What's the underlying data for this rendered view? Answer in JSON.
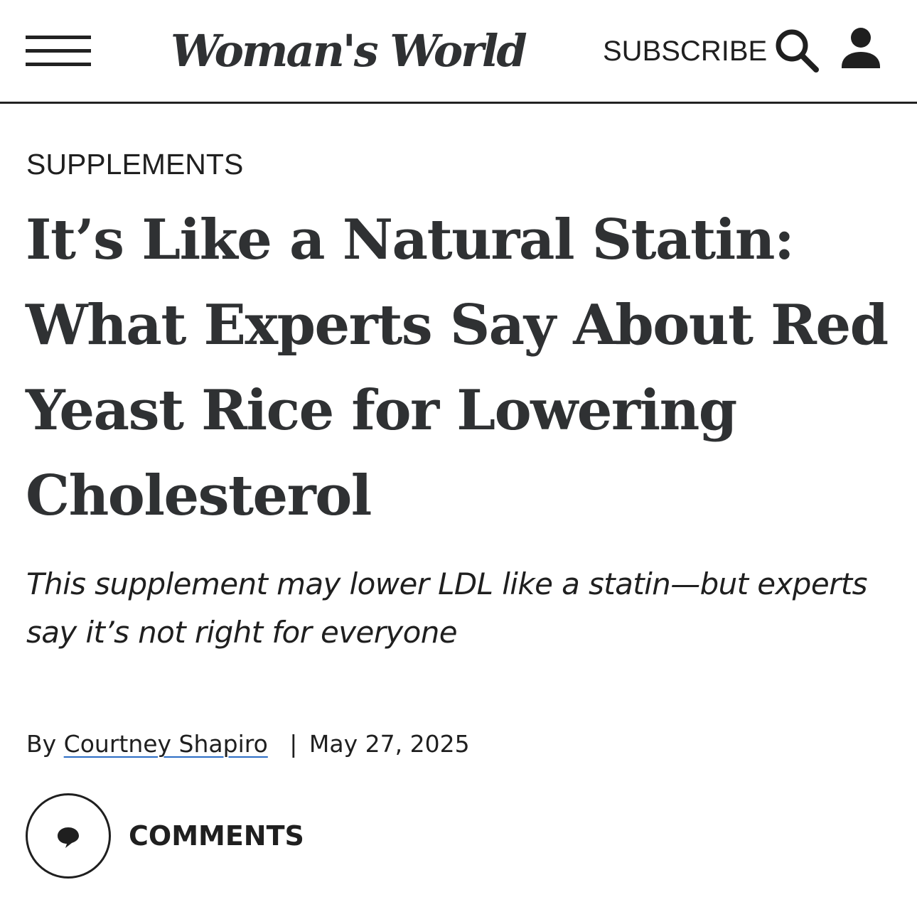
{
  "header": {
    "logo_text": "Woman's World",
    "subscribe_label": "SUBSCRIBE",
    "menu_icon": "hamburger-menu-icon",
    "search_icon": "search-icon",
    "user_icon": "user-account-icon"
  },
  "article": {
    "category": "SUPPLEMENTS",
    "headline": "It’s Like a Natural Statin: What Experts Say About Red Yeast Rice for Lowering Cholesterol",
    "dek": "This supplement may lower LDL like a statin—but experts say it’s not right for everyone",
    "byline_prefix": "By",
    "author": "Courtney Shapiro",
    "separator": "|",
    "date": "May 27, 2025",
    "comments_label": "COMMENTS",
    "comments_icon": "speech-bubble-icon"
  },
  "colors": {
    "text": "#1f1f1f",
    "headline": "#2f3133",
    "author_underline": "#2a6cc4",
    "divider": "#222222"
  }
}
